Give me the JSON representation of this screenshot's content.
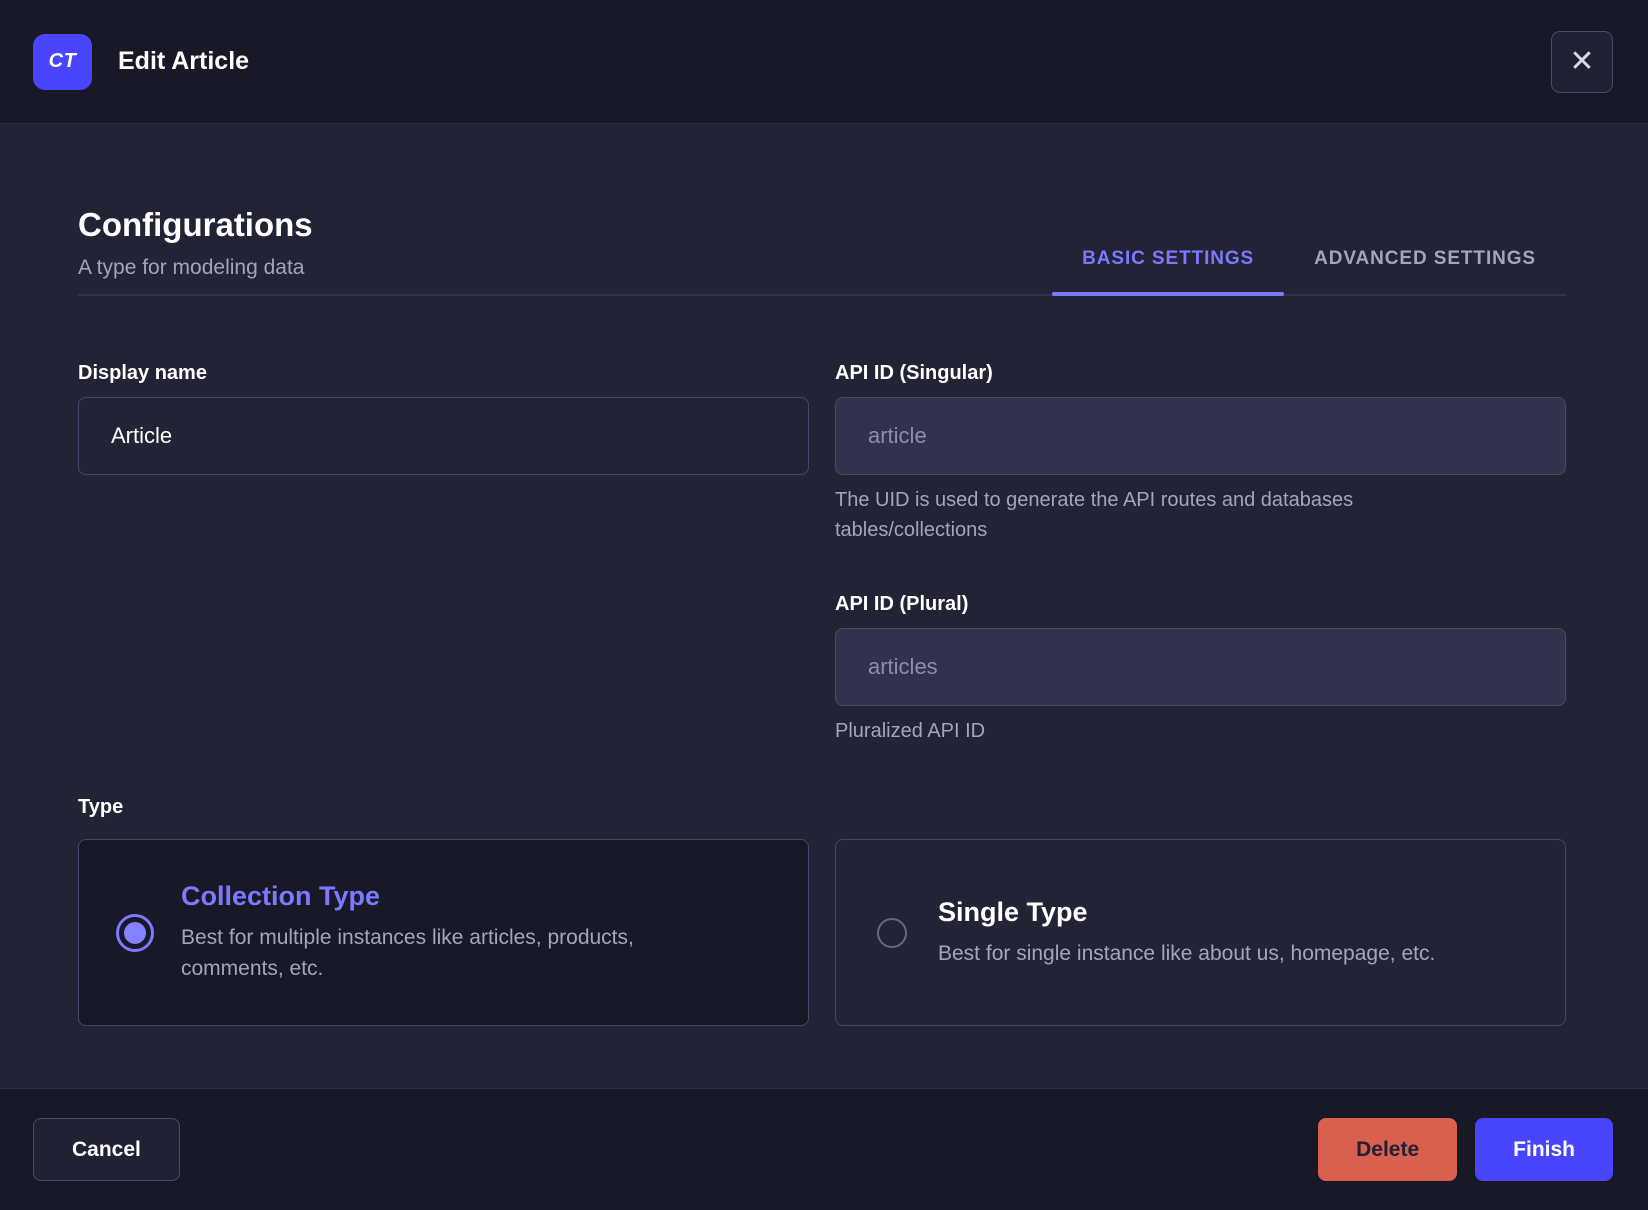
{
  "header": {
    "badge": "CT",
    "title": "Edit Article",
    "close_icon": "✕"
  },
  "content": {
    "heading": "Configurations",
    "subheading": "A type for modeling data",
    "tabs": [
      {
        "label": "BASIC SETTINGS",
        "active": true
      },
      {
        "label": "ADVANCED SETTINGS",
        "active": false
      }
    ],
    "fields": {
      "display_name": {
        "label": "Display name",
        "value": "Article"
      },
      "api_id_singular": {
        "label": "API ID (Singular)",
        "placeholder": "article",
        "hint": "The UID is used to generate the API routes and databases tables/collections"
      },
      "api_id_plural": {
        "label": "API ID (Plural)",
        "placeholder": "articles",
        "hint": "Pluralized API ID"
      }
    },
    "type": {
      "label": "Type",
      "options": [
        {
          "title": "Collection Type",
          "description": "Best for multiple instances like articles, products, comments, etc.",
          "selected": true
        },
        {
          "title": "Single Type",
          "description": "Best for single instance like about us, homepage, etc.",
          "selected": false
        }
      ]
    }
  },
  "footer": {
    "cancel_label": "Cancel",
    "delete_label": "Delete",
    "finish_label": "Finish"
  },
  "colors": {
    "accent": "#4945ff",
    "accent_light": "#7b79ff",
    "danger": "#d9604f"
  }
}
